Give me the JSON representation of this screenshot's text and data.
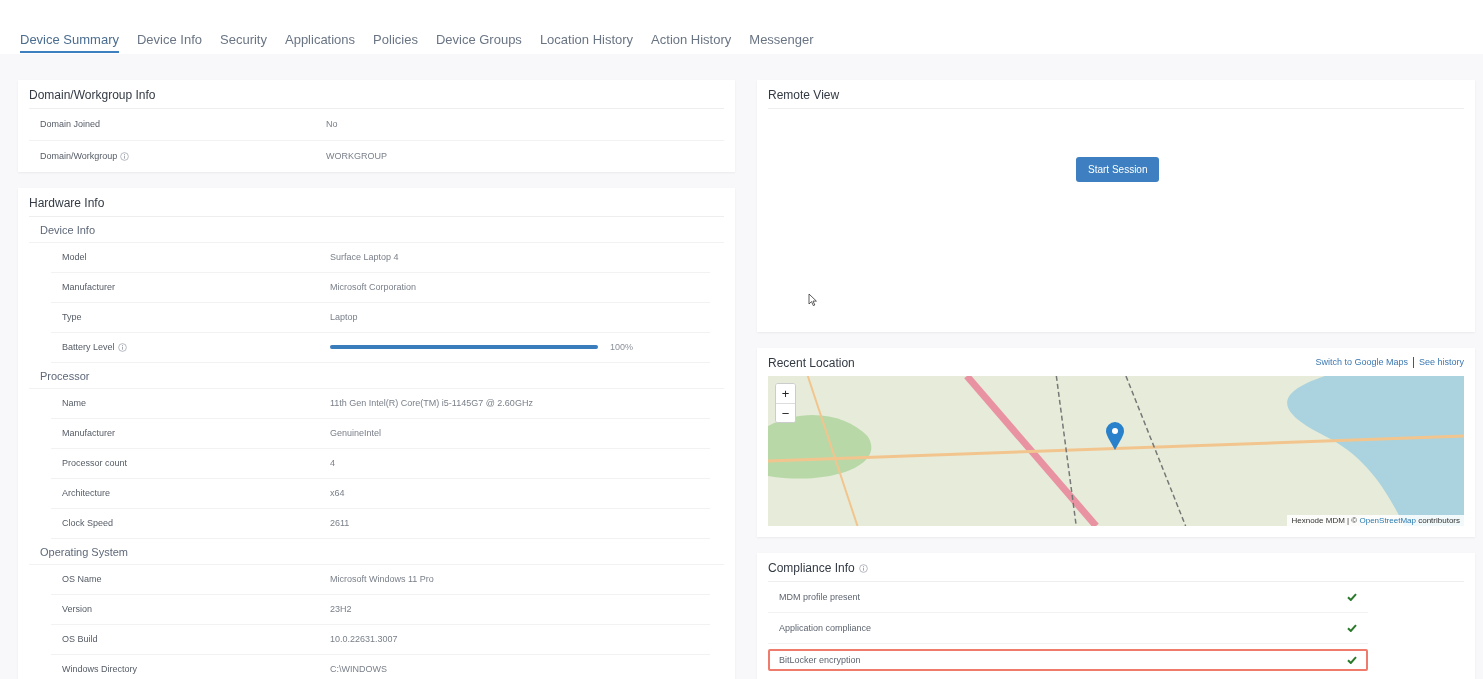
{
  "tabs": [
    {
      "label": "Device Summary",
      "selected": true
    },
    {
      "label": "Device Info",
      "selected": false
    },
    {
      "label": "Security",
      "selected": false
    },
    {
      "label": "Applications",
      "selected": false
    },
    {
      "label": "Policies",
      "selected": false
    },
    {
      "label": "Device Groups",
      "selected": false
    },
    {
      "label": "Location History",
      "selected": false
    },
    {
      "label": "Action History",
      "selected": false
    },
    {
      "label": "Messenger",
      "selected": false
    }
  ],
  "domain_card": {
    "title": "Domain/Workgroup Info",
    "rows": [
      {
        "label": "Domain Joined",
        "value": "No",
        "info": false
      },
      {
        "label": "Domain/Workgroup",
        "value": "WORKGROUP",
        "info": true
      }
    ]
  },
  "hardware_card": {
    "title": "Hardware Info",
    "groups": [
      {
        "title": "Device Info",
        "rows": [
          {
            "kind": "text",
            "label": "Model",
            "value": "Surface Laptop 4",
            "info": false
          },
          {
            "kind": "text",
            "label": "Manufacturer",
            "value": "Microsoft Corporation",
            "info": false
          },
          {
            "kind": "text",
            "label": "Type",
            "value": "Laptop",
            "info": false
          },
          {
            "kind": "bar",
            "label": "Battery Level",
            "level": 1.0,
            "reading": "100%",
            "info": true
          }
        ]
      },
      {
        "title": "Processor",
        "rows": [
          {
            "kind": "text",
            "label": "Name",
            "value": "11th Gen Intel(R) Core(TM) i5-1145G7 @ 2.60GHz",
            "info": false
          },
          {
            "kind": "text",
            "label": "Manufacturer",
            "value": "GenuineIntel",
            "info": false
          },
          {
            "kind": "text",
            "label": "Processor count",
            "value": "4",
            "info": false
          },
          {
            "kind": "text",
            "label": "Architecture",
            "value": "x64",
            "info": false
          },
          {
            "kind": "text",
            "label": "Clock Speed",
            "value": "2611",
            "info": false
          }
        ]
      },
      {
        "title": "Operating System",
        "rows": [
          {
            "kind": "text",
            "label": "OS Name",
            "value": "Microsoft Windows 11 Pro",
            "info": false
          },
          {
            "kind": "text",
            "label": "Version",
            "value": "23H2",
            "info": false
          },
          {
            "kind": "text",
            "label": "OS Build",
            "value": "10.0.22631.3007",
            "info": false
          },
          {
            "kind": "text",
            "label": "Windows Directory",
            "value": "C:\\WINDOWS",
            "info": false
          }
        ]
      }
    ]
  },
  "remote_view": {
    "title": "Remote View",
    "button": "Start Session"
  },
  "recent_location": {
    "title": "Recent Location",
    "links": [
      "Switch to Google Maps",
      "See history"
    ],
    "zoom_in": "+",
    "zoom_out": "−",
    "attribution_prefix": "Hexnode MDM | ©",
    "attribution_link": "OpenStreetMap",
    "attribution_suffix": "contributors"
  },
  "compliance": {
    "title": "Compliance Info",
    "info": true,
    "items": [
      {
        "label": "MDM profile present",
        "checked": true,
        "highlighted": false
      },
      {
        "label": "Application compliance",
        "checked": true,
        "highlighted": false
      },
      {
        "label": "BitLocker encryption",
        "checked": true,
        "highlighted": true
      }
    ]
  }
}
